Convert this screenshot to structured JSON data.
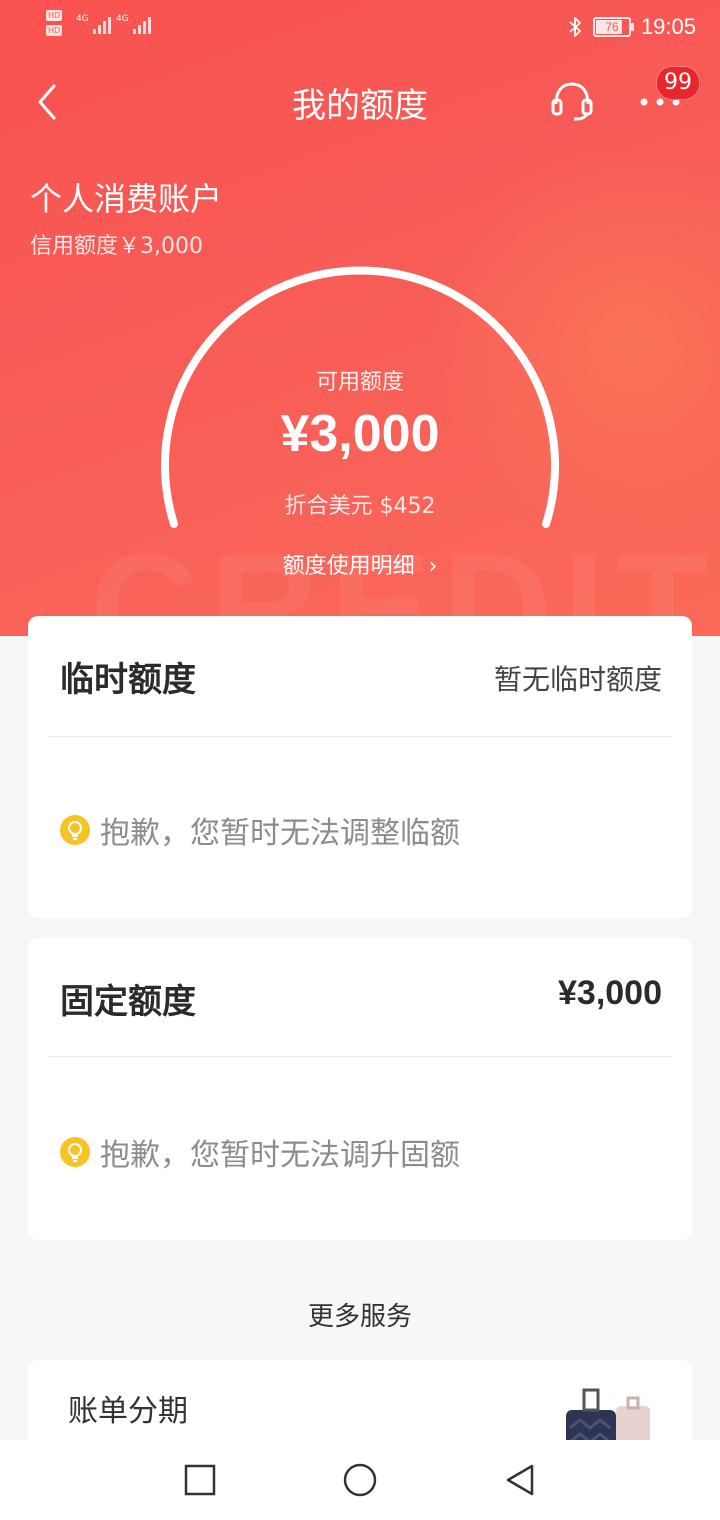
{
  "status_bar": {
    "hd_label": "HD",
    "signal1_label": "4G",
    "signal2_label": "4G",
    "battery": "76",
    "time": "19:05"
  },
  "header": {
    "title": "我的额度",
    "badge": "99"
  },
  "account": {
    "name": "个人消费账户",
    "credit_line": "信用额度￥3,000"
  },
  "gauge": {
    "label": "可用额度",
    "amount": "¥3,000",
    "usd": "折合美元 $452",
    "detail_link": "额度使用明细",
    "watermark": "CREDIT"
  },
  "temp_quota": {
    "title": "临时额度",
    "value": "暂无临时额度",
    "tip": "抱歉，您暂时无法调整临额"
  },
  "fixed_quota": {
    "title": "固定额度",
    "value": "¥3,000",
    "tip": "抱歉，您暂时无法调升固额"
  },
  "more_services": {
    "title": "更多服务",
    "items": [
      {
        "label": "账单分期"
      }
    ]
  },
  "colors": {
    "brand_red": "#f75855",
    "badge_red": "#e8262b",
    "tip_yellow": "#f7c325"
  }
}
